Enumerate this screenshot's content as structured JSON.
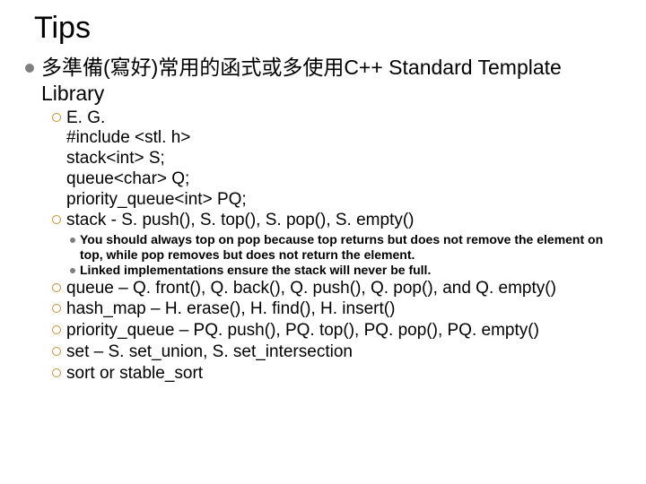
{
  "title": "Tips",
  "main": "多準備(寫好)常用的函式或多使用C++ Standard Template Library",
  "eg": {
    "label": "E. G.",
    "l1": "#include <stl. h>",
    "l2": "stack<int> S;",
    "l3": "queue<char> Q;",
    "l4": "priority_queue<int> PQ;"
  },
  "stack": "stack - S. push(), S. top(), S. pop(), S. empty()",
  "note1": "You should always top on pop because top returns but does not remove the element on top, while pop removes but does not return the element.",
  "note2": "Linked implementations ensure the stack will never be full.",
  "queue": "queue – Q. front(), Q. back(), Q. push(), Q. pop(), and Q. empty()",
  "hash": "hash_map – H. erase(), H. find(), H. insert()",
  "pq": "priority_queue – PQ. push(), PQ. top(), PQ. pop(), PQ. empty()",
  "set": "set – S. set_union, S. set_intersection",
  "sort": "sort or stable_sort"
}
